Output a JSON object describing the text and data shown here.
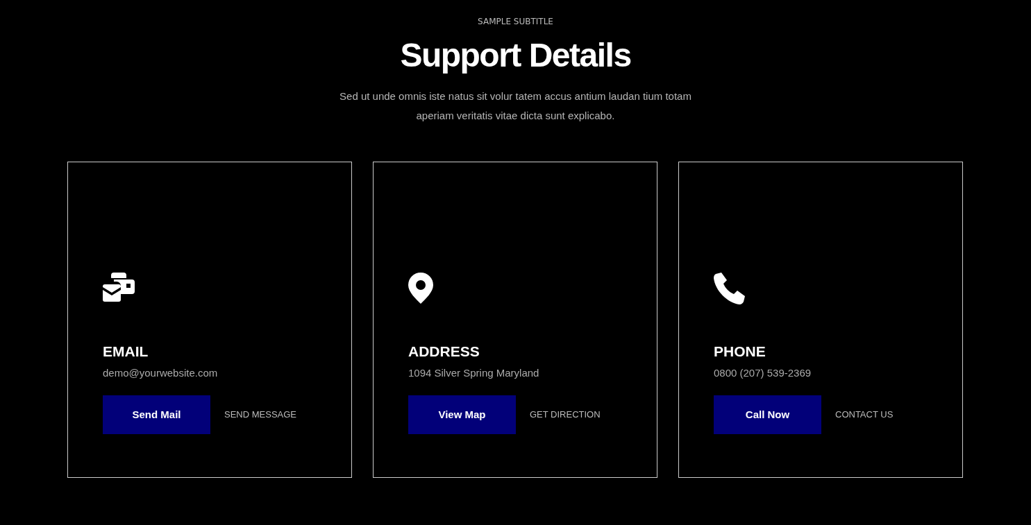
{
  "header": {
    "subtitle": "SAMPLE SUBTITLE",
    "title": "Support Details",
    "description": "Sed ut unde omnis iste natus sit volur tatem accus antium laudan tium totam aperiam veritatis vitae dicta sunt explicabo."
  },
  "cards": [
    {
      "kind": "email",
      "title": "EMAIL",
      "detail": "demo@yourwebsite.com",
      "button": "Send Mail",
      "link": "SEND MESSAGE"
    },
    {
      "kind": "location",
      "title": "ADDRESS",
      "detail": "1094 Silver Spring Maryland",
      "button": "View Map",
      "link": "GET DIRECTION"
    },
    {
      "kind": "phone",
      "title": "PHONE",
      "detail": "0800 (207) 539-2369",
      "button": "Call Now",
      "link": "CONTACT US"
    }
  ]
}
